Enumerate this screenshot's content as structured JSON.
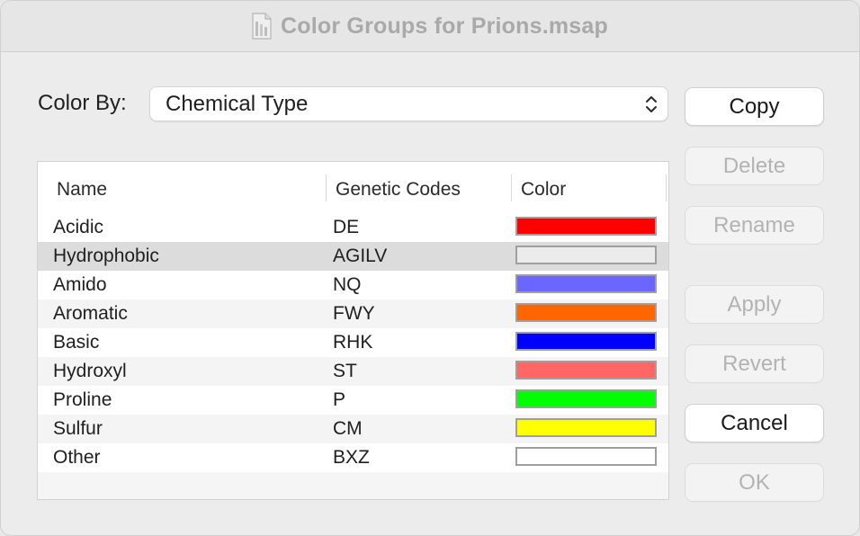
{
  "window": {
    "title": "Color Groups for Prions.msap",
    "title_icon": "document-icon"
  },
  "color_by": {
    "label": "Color By:",
    "selected": "Chemical Type"
  },
  "table": {
    "columns": [
      "Name",
      "Genetic Codes",
      "Color"
    ],
    "rows": [
      {
        "name": "Acidic",
        "codes": "DE",
        "color": "#ff0000",
        "selected": false
      },
      {
        "name": "Hydrophobic",
        "codes": "AGILV",
        "color": "#ebebeb",
        "selected": true
      },
      {
        "name": "Amido",
        "codes": "NQ",
        "color": "#6a66ff",
        "selected": false
      },
      {
        "name": "Aromatic",
        "codes": "FWY",
        "color": "#ff6600",
        "selected": false
      },
      {
        "name": "Basic",
        "codes": "RHK",
        "color": "#0000ff",
        "selected": false
      },
      {
        "name": "Hydroxyl",
        "codes": "ST",
        "color": "#ff6666",
        "selected": false
      },
      {
        "name": "Proline",
        "codes": "P",
        "color": "#00ff00",
        "selected": false
      },
      {
        "name": "Sulfur",
        "codes": "CM",
        "color": "#ffff00",
        "selected": false
      },
      {
        "name": "Other",
        "codes": "BXZ",
        "color": "#ffffff",
        "selected": false
      }
    ]
  },
  "buttons": {
    "copy": {
      "label": "Copy",
      "enabled": true
    },
    "delete": {
      "label": "Delete",
      "enabled": false
    },
    "rename": {
      "label": "Rename",
      "enabled": false
    },
    "apply": {
      "label": "Apply",
      "enabled": false
    },
    "revert": {
      "label": "Revert",
      "enabled": false
    },
    "cancel": {
      "label": "Cancel",
      "enabled": true
    },
    "ok": {
      "label": "OK",
      "enabled": false
    }
  }
}
